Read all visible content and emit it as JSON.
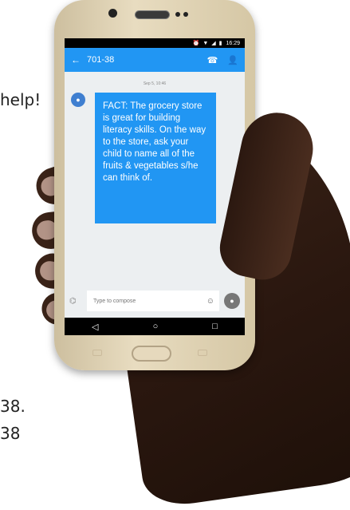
{
  "background": {
    "text_help": "help!",
    "text_38a": "38.",
    "text_38b": "38"
  },
  "status_bar": {
    "time": "16:29",
    "icons": "⏰ ▼ ◢ ▮"
  },
  "app_bar": {
    "title": "701-38",
    "back_icon": "←",
    "call_icon": "☎",
    "contact_icon": "👤",
    "color": "#2196f3"
  },
  "conversation": {
    "date": "Sep 5, 10:46",
    "message": "FACT: The grocery store is great for building literacy skills. On the way to the store, ask your child to name all of the fruits & vegetables s/he can think of."
  },
  "compose": {
    "placeholder": "Type to compose"
  },
  "nav": {
    "back": "◁",
    "home": "○",
    "recents": "□"
  }
}
